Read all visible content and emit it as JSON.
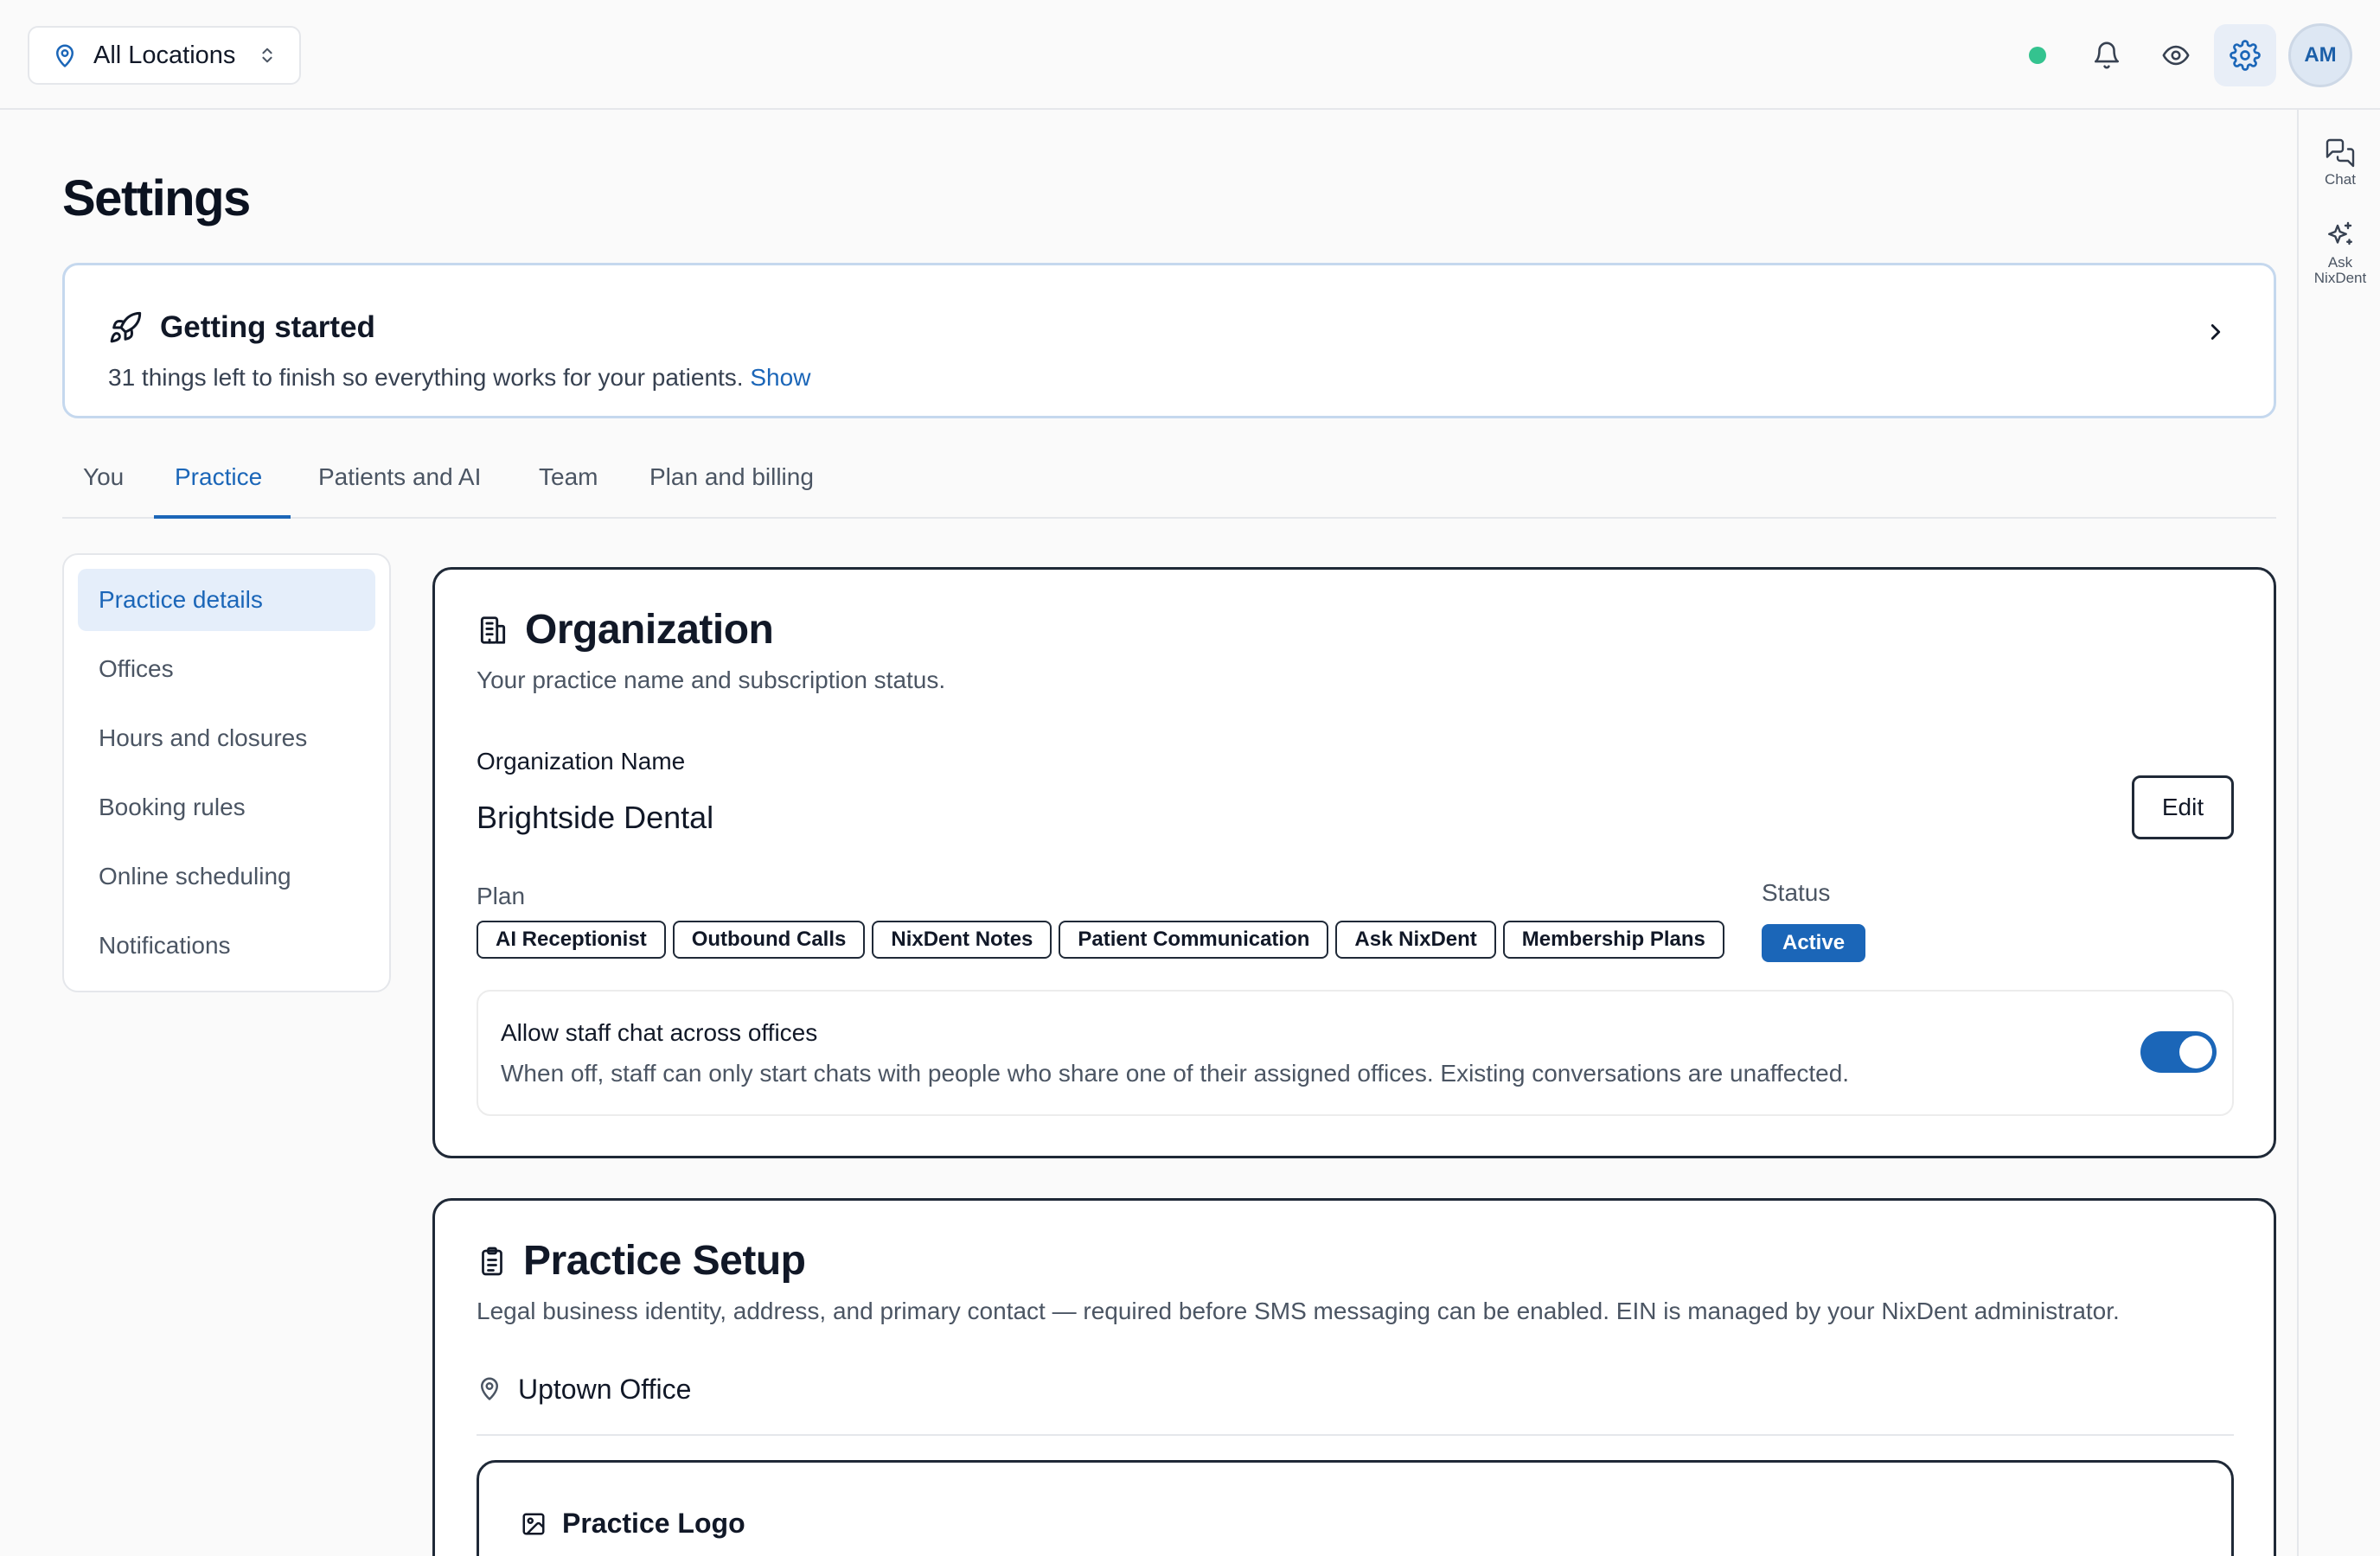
{
  "topbar": {
    "location_label": "All Locations",
    "avatar_initials": "AM",
    "icons": [
      "pin-icon",
      "updown-chevron-icon",
      "bell-icon",
      "eye-icon",
      "gear-icon"
    ]
  },
  "rail": {
    "chat_label": "Chat",
    "ask_label_line1": "Ask",
    "ask_label_line2": "NixDent"
  },
  "page": {
    "title": "Settings"
  },
  "getting_started": {
    "title": "Getting started",
    "subtitle": "31 things left to finish so everything works for your patients.",
    "show_link": "Show"
  },
  "tabs": [
    {
      "label": "You",
      "active": false
    },
    {
      "label": "Practice",
      "active": true
    },
    {
      "label": "Patients and AI",
      "active": false
    },
    {
      "label": "Team",
      "active": false
    },
    {
      "label": "Plan and billing",
      "active": false
    }
  ],
  "sidenav": [
    {
      "label": "Practice details",
      "active": true
    },
    {
      "label": "Offices",
      "active": false
    },
    {
      "label": "Hours and closures",
      "active": false
    },
    {
      "label": "Booking rules",
      "active": false
    },
    {
      "label": "Online scheduling",
      "active": false
    },
    {
      "label": "Notifications",
      "active": false
    }
  ],
  "organization": {
    "title": "Organization",
    "description": "Your practice name and subscription status.",
    "name_label": "Organization Name",
    "name_value": "Brightside Dental",
    "edit_label": "Edit",
    "plan_label": "Plan",
    "plan_chips": [
      "AI Receptionist",
      "Outbound Calls",
      "NixDent Notes",
      "Patient Communication",
      "Ask NixDent",
      "Membership Plans"
    ],
    "status_label": "Status",
    "status_value": "Active",
    "staff_chat_title": "Allow staff chat across offices",
    "staff_chat_desc": "When off, staff can only start chats with people who share one of their assigned offices. Existing conversations are unaffected.",
    "staff_chat_enabled": true
  },
  "practice_setup": {
    "title": "Practice Setup",
    "description": "Legal business identity, address, and primary contact — required before SMS messaging can be enabled. EIN is managed by your NixDent administrator.",
    "office_name": "Uptown Office",
    "logo_title": "Practice Logo"
  },
  "colors": {
    "accent": "#1b66b8",
    "status_online": "#34c38f",
    "active_tab_bg": "#e5eefa"
  }
}
